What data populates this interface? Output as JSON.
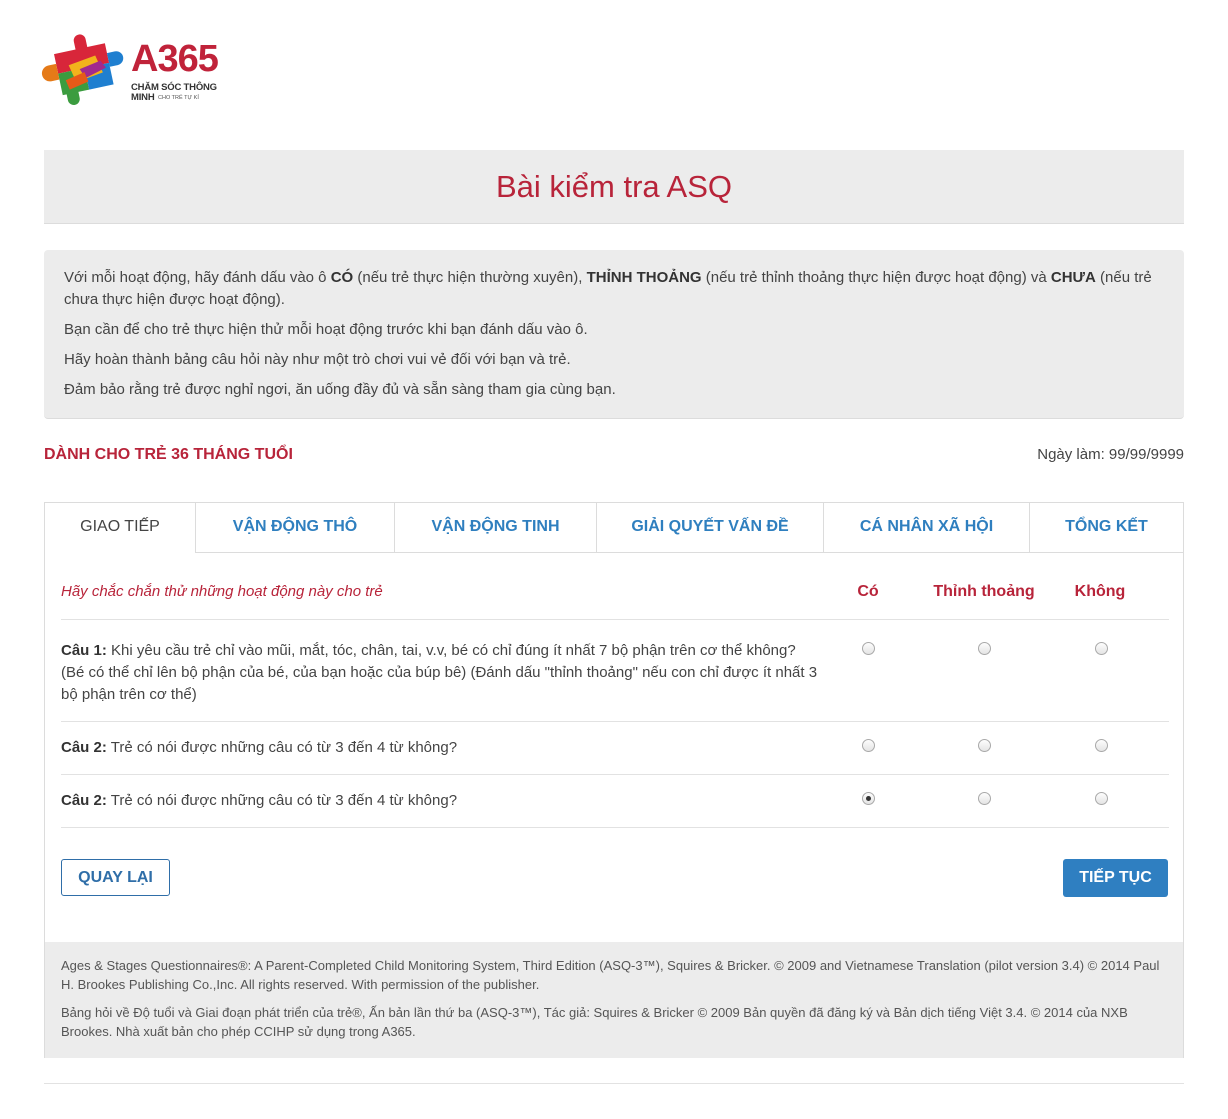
{
  "logo": {
    "title": "A365",
    "subtitle": "CHĂM SÓC THÔNG MINH",
    "tagline": "CHO TRẺ TỰ KỈ"
  },
  "page_title": "Bài kiểm tra ASQ",
  "instructions": {
    "p1_a": "Với mỗi hoạt động, hãy đánh dấu vào ô ",
    "p1_b": "CÓ",
    "p1_c": " (nếu trẻ thực hiện thường xuyên), ",
    "p1_d": "THỈNH THOẢNG",
    "p1_e": " (nếu trẻ thỉnh thoảng thực hiện được hoạt động) và ",
    "p1_f": "CHƯA",
    "p1_g": " (nếu trẻ chưa thực hiện được hoạt động).",
    "p2": "Bạn cần để cho trẻ thực hiện thử mỗi hoạt động trước khi bạn đánh dấu vào ô.",
    "p3": "Hãy hoàn thành bảng câu hỏi này như một trò chơi vui vẻ đối với bạn và trẻ.",
    "p4": "Đảm bảo rằng trẻ được nghỉ ngơi, ăn uống đầy đủ và sẵn sàng tham gia cùng bạn."
  },
  "age_label": "DÀNH CHO TRẺ 36 THÁNG TUỔI",
  "date_label": "Ngày làm: 99/99/9999",
  "tabs": [
    {
      "label": "GIAO TIẾP"
    },
    {
      "label": "VẬN ĐỘNG THÔ"
    },
    {
      "label": "VẬN ĐỘNG TINH"
    },
    {
      "label": "GIẢI QUYẾT VẤN ĐỀ"
    },
    {
      "label": "CÁ NHÂN XÃ HỘI"
    },
    {
      "label": "TỔNG KẾT"
    }
  ],
  "active_tab": "GIAO TIẾP",
  "table": {
    "hint": "Hãy chắc chắn thử những hoạt động này cho trẻ",
    "col_yes": "Có",
    "col_sometimes": "Thỉnh thoảng",
    "col_no": "Không",
    "questions": [
      {
        "label": "Câu 1:",
        "text": " Khi yêu cầu trẻ chỉ vào mũi, mắt, tóc, chân, tai, v.v, bé có chỉ đúng ít nhất 7 bộ phận trên cơ thể không? (Bé có thể chỉ lên bộ phận của bé, của bạn hoặc của búp bê) (Đánh dấu \"thỉnh thoảng\" nếu con chỉ được ít nhất 3 bộ phận trên cơ thể)",
        "selected": null
      },
      {
        "label": "Câu 2:",
        "text": " Trẻ có nói được những câu có từ 3 đến 4 từ không?",
        "selected": null
      },
      {
        "label": "Câu 2:",
        "text": " Trẻ có nói được những câu có từ 3 đến 4 từ không?",
        "selected": "Có"
      }
    ]
  },
  "buttons": {
    "back": "QUAY LẠI",
    "next": "TIẾP TỤC"
  },
  "footer": {
    "en": "Ages & Stages Questionnaires®: A Parent-Completed Child Monitoring System, Third Edition (ASQ-3™), Squires & Bricker. © 2009 and Vietnamese Translation (pilot version 3.4) © 2014 Paul H. Brookes Publishing Co.,Inc. All rights reserved. With permission of the publisher.",
    "vi": "Bảng hỏi về Độ tuổi và Giai đoạn phát triển của trẻ®, Ấn bản lần thứ ba (ASQ-3™), Tác giả: Squires & Bricker © 2009 Bản quyền đã đăng ký và Bản dịch tiếng Việt 3.4. © 2014 của NXB Brookes. Nhà xuất bản cho phép CCIHP sử dụng trong A365."
  },
  "colors": {
    "brand_red": "#b8243a",
    "link_blue": "#2f7fbf",
    "button_blue": "#2f7fc1",
    "panel_gray": "#ececec"
  }
}
